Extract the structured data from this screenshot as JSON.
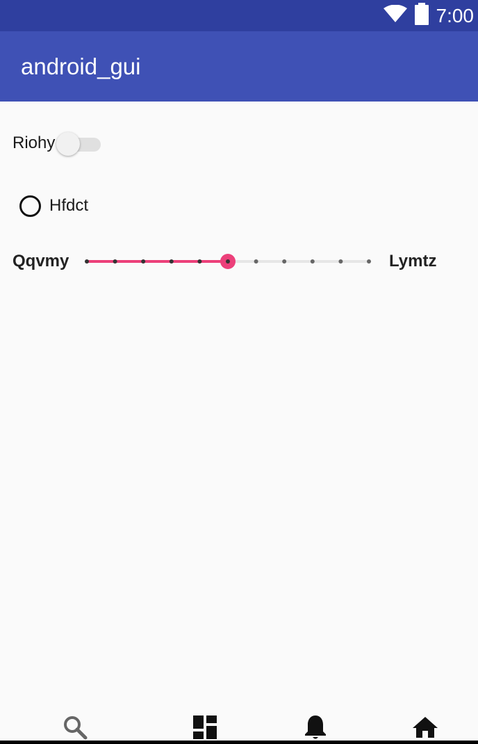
{
  "status_bar": {
    "time": "7:00",
    "icons": [
      "wifi-icon",
      "battery-icon"
    ],
    "color": "#2f3f9f"
  },
  "app_bar": {
    "title": "android_gui",
    "color": "#3f51b5"
  },
  "form": {
    "switch": {
      "label": "Riohy",
      "checked": false
    },
    "radio": {
      "label": "Hfdct",
      "selected": false
    },
    "slider": {
      "min_label": "Qqvmy",
      "max_label": "Lymtz",
      "steps": 10,
      "value_step": 5,
      "accent": "#ec407a"
    }
  },
  "bottom_nav": {
    "items": [
      {
        "icon": "search-icon"
      },
      {
        "icon": "dashboard-icon"
      },
      {
        "icon": "notifications-icon"
      },
      {
        "icon": "home-icon"
      }
    ]
  }
}
